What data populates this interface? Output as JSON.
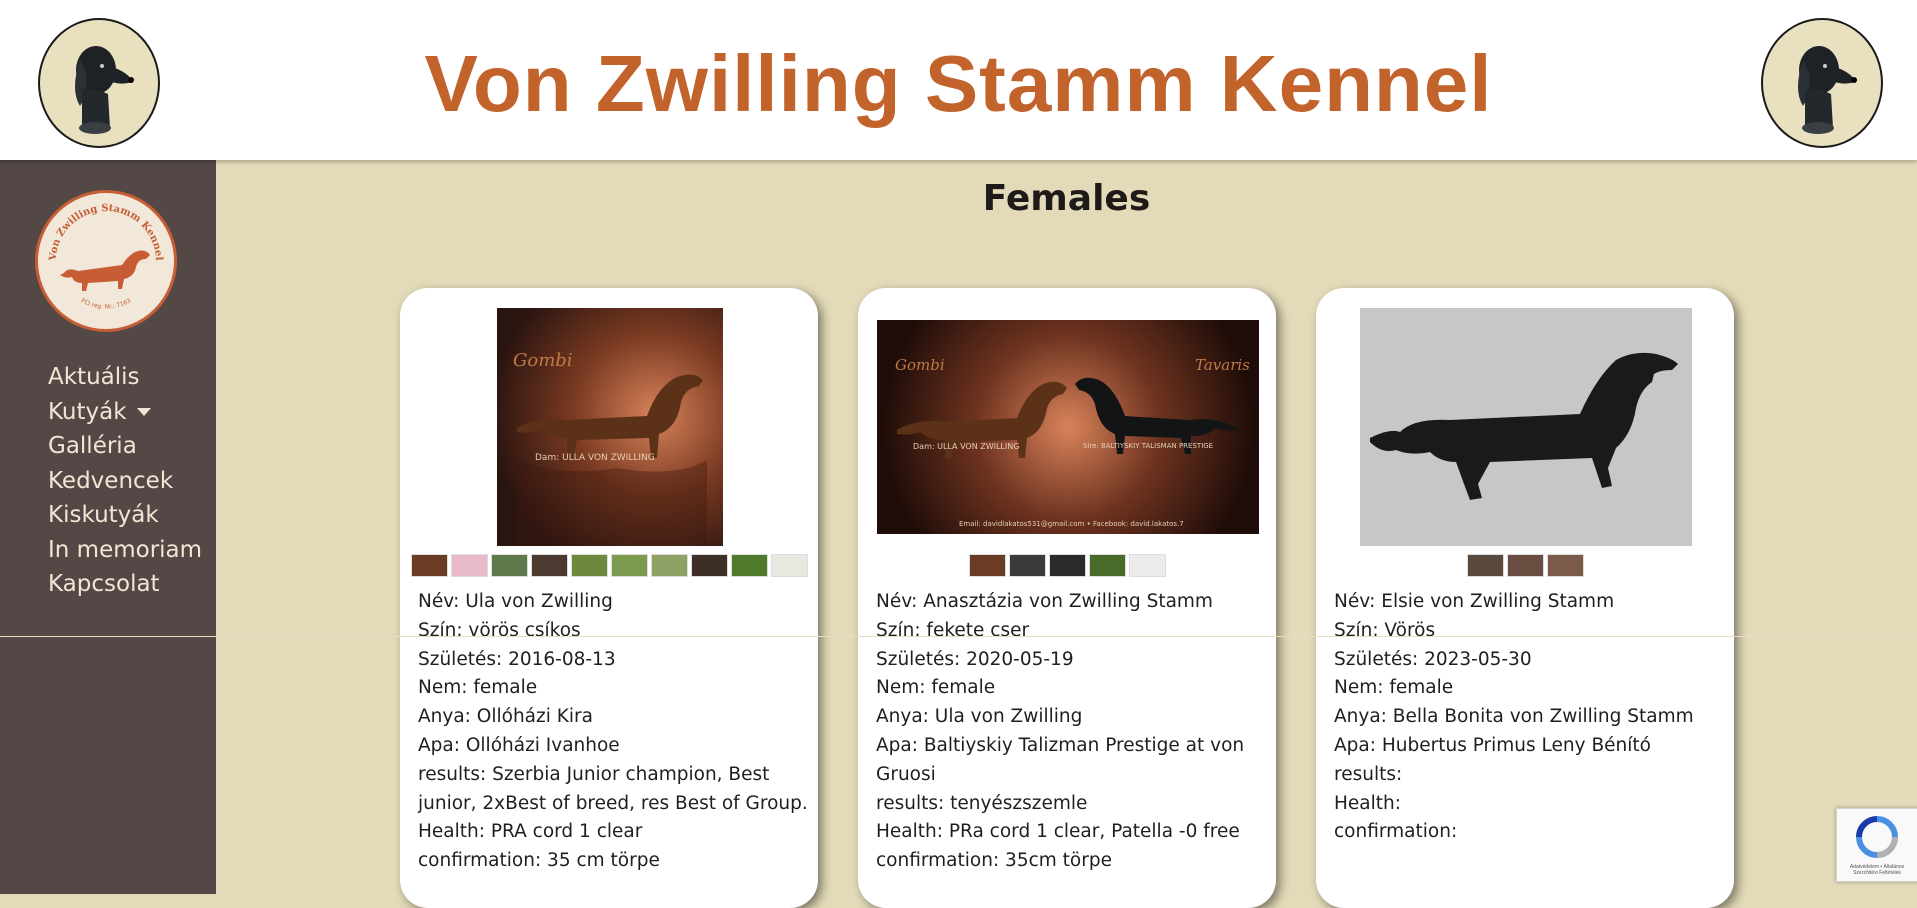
{
  "header": {
    "title": "Von Zwilling Stamm Kennel"
  },
  "sidebar": {
    "logo_text_top": "Von Zwilling Stamm Kennel",
    "logo_text_bottom": "FCI reg. Nr.: 7163",
    "items": [
      {
        "label": "Aktuális"
      },
      {
        "label": "Kutyák"
      },
      {
        "label": "Galléria"
      },
      {
        "label": "Kedvencek"
      },
      {
        "label": "Kiskutyák"
      },
      {
        "label": "In memoriam"
      },
      {
        "label": "Kapcsolat"
      }
    ]
  },
  "main": {
    "heading": "Females",
    "cards": [
      {
        "photo_name_left": "Gombi",
        "photo_dam": "Dam: ULLA VON ZWILLING",
        "name_label": "Név: Ula von Zwilling",
        "color_label": "Szín: vörös csíkos",
        "birth_label": "Születés: 2016-08-13",
        "sex_label": "Nem: female",
        "mother_label": "Anya: Ollóházi Kira",
        "father_label": "Apa: Ollóházi Ivanhoe",
        "results_label": "results: Szerbia Junior champion, Best junior, 2xBest of breed, res Best of Group.",
        "health_label": "Health: PRA cord 1 clear",
        "confirmation_label": "confirmation: 35 cm törpe"
      },
      {
        "photo_name_left": "Gombi",
        "photo_name_right": "Tavaris",
        "photo_dam": "Dam: ULLA VON ZWILLING",
        "photo_sire": "Sire: BALTIYSKIY TALISMAN PRESTIGE",
        "photo_contact": "Email: davidlakatos531@gmail.com  •  Facebook: david.lakatos.7",
        "name_label": "Név: Anasztázia von Zwilling Stamm",
        "color_label": "Szín: fekete cser",
        "birth_label": "Születés: 2020-05-19",
        "sex_label": "Nem: female",
        "mother_label": "Anya: Ula von Zwilling",
        "father_label": "Apa: Baltiyskiy Talizman Prestige at von Gruosi",
        "results_label": "results: tenyészszemle",
        "health_label": "Health:  PRa cord 1 clear, Patella -0 free",
        "confirmation_label": "confirmation: 35cm törpe"
      },
      {
        "name_label": "Név: Elsie von Zwilling Stamm",
        "color_label": "Szín: Vörös",
        "birth_label": "Születés: 2023-05-30",
        "sex_label": "Nem: female",
        "mother_label": "Anya: Bella Bonita von Zwilling Stamm",
        "father_label": "Apa: Hubertus Primus Leny Bénító",
        "results_label": "results:",
        "health_label": "Health:",
        "confirmation_label": "confirmation:"
      }
    ]
  },
  "recaptcha": {
    "text": "Adatvédelem • Általános Szerződési Feltételek"
  },
  "colors": {
    "title": "#c2632c",
    "sidebar_bg": "#544846",
    "page_bg": "#e2dab8",
    "nav_text": "#f0e6d4"
  }
}
